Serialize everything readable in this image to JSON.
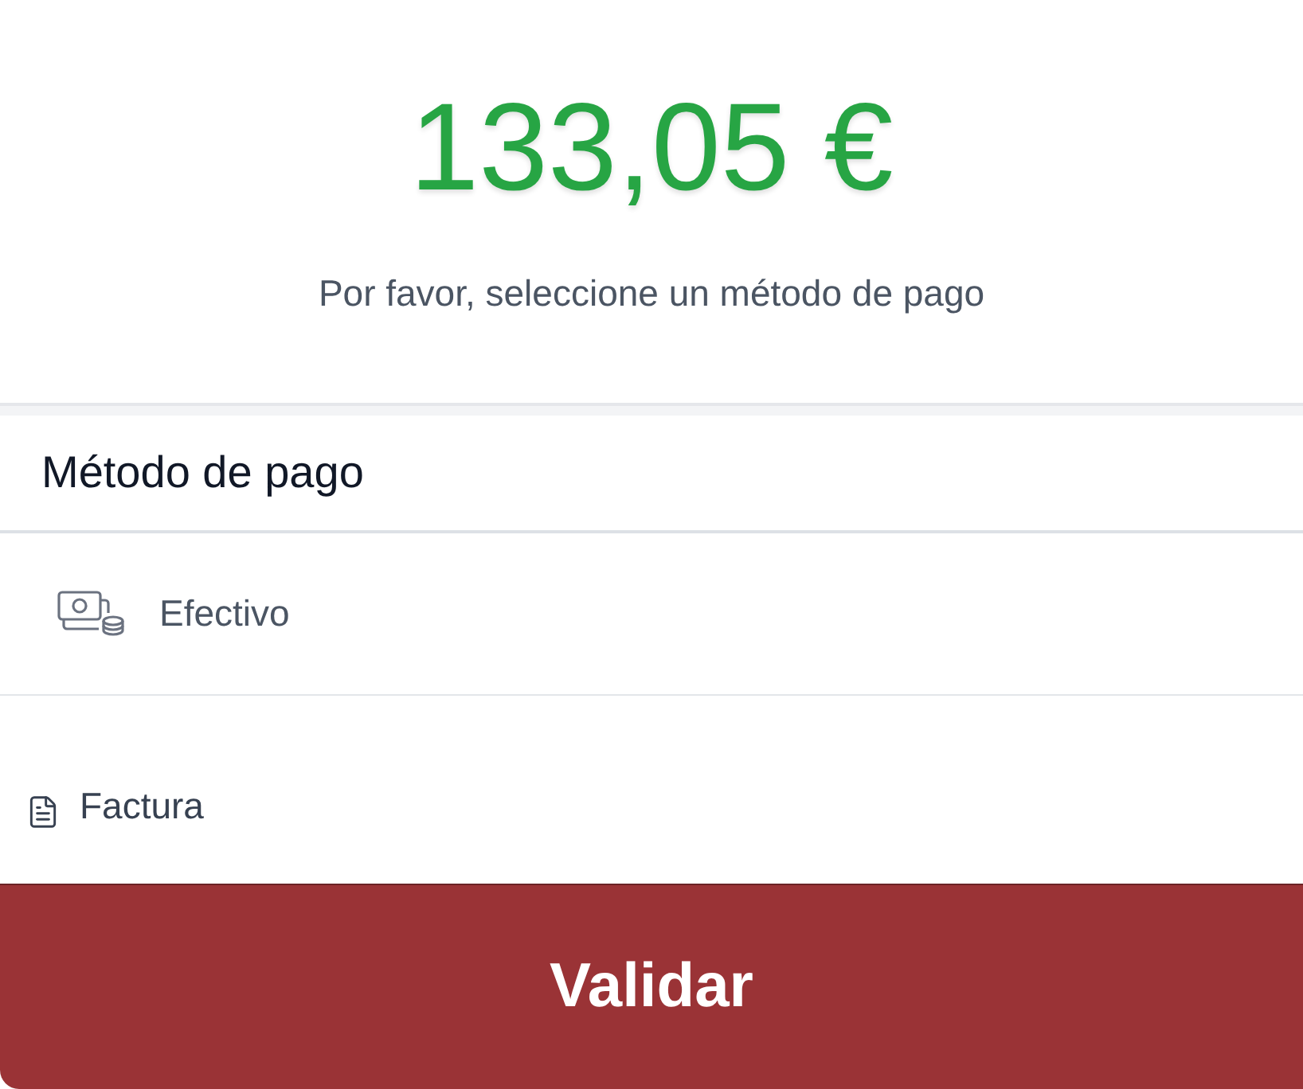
{
  "total": {
    "amount": "133,05 €",
    "prompt": "Por favor, seleccione un método de pago"
  },
  "payment_section": {
    "title": "Método de pago",
    "methods": [
      {
        "kind": "cash",
        "label": "Efectivo"
      }
    ]
  },
  "invoice": {
    "label": "Factura"
  },
  "validate_button": {
    "label": "Validar"
  }
}
